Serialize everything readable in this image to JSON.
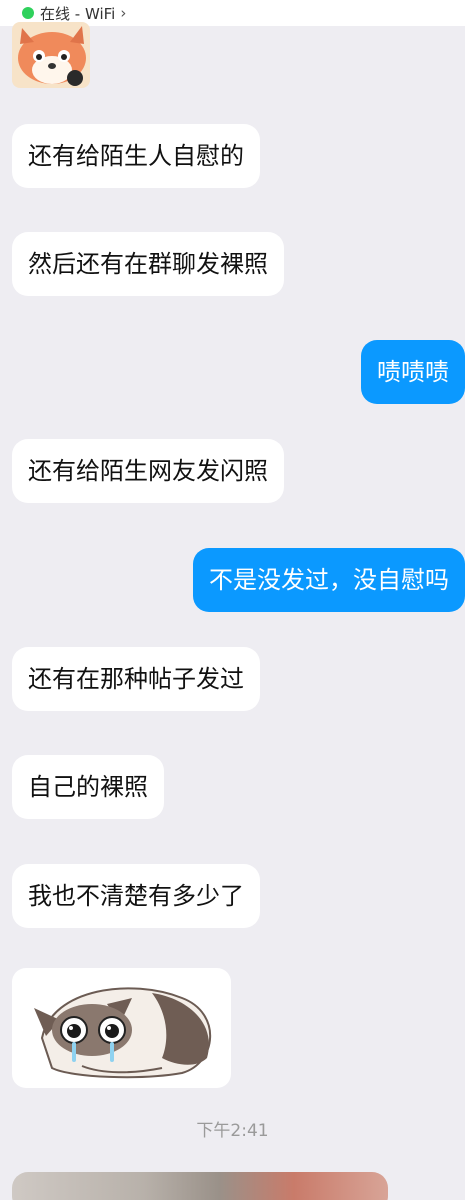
{
  "status": {
    "text": "在线 - WiFi"
  },
  "messages": [
    {
      "text": "还有给陌生人自慰的"
    },
    {
      "text": "然后还有在群聊发裸照"
    },
    {
      "text": "啧啧啧"
    },
    {
      "text": "还有给陌生网友发闪照"
    },
    {
      "text": "不是没发过，没自慰吗"
    },
    {
      "text": "还有在那种帖子发过"
    },
    {
      "text": "自己的裸照"
    },
    {
      "text": "我也不清楚有多少了"
    }
  ],
  "time_separator": "下午2:41",
  "colors": {
    "outgoing": "#0B99FF",
    "incoming": "#FFFFFF",
    "background": "#EEEDF2",
    "online": "#2FD15C"
  },
  "icons": {
    "fox_sticker": "fox-sticker-icon",
    "cat_sticker": "crying-cat-sticker-icon",
    "chevron": "chevron-right-icon"
  }
}
